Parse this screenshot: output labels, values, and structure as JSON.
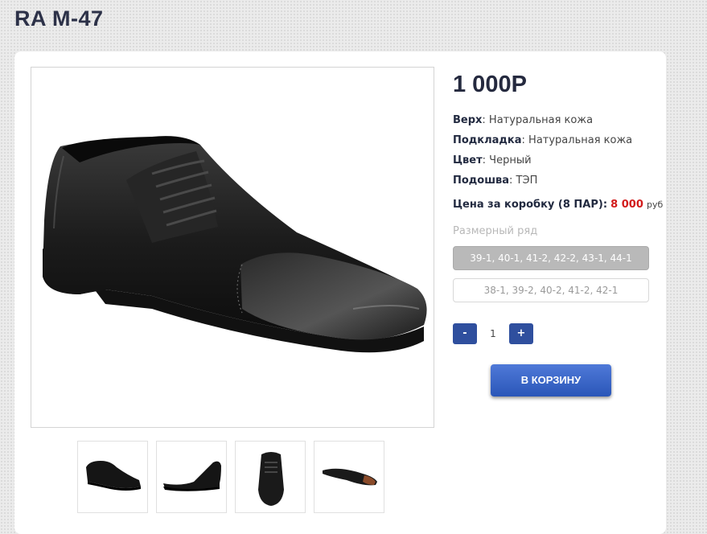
{
  "product": {
    "title": "RA M-47",
    "price": "1 000Р"
  },
  "attributes": [
    {
      "label": "Верх",
      "value": ": Натуральная кожа"
    },
    {
      "label": "Подкладка",
      "value": ": Натуральная кожа"
    },
    {
      "label": "Цвет",
      "value": ": Черный"
    },
    {
      "label": "Подошва",
      "value": ": ТЭП"
    }
  ],
  "box_price": {
    "label": "Цена за коробку (8 ПАР):",
    "value": "8 000",
    "currency": "руб"
  },
  "sizes": {
    "label": "Размерный ряд",
    "options": [
      {
        "text": "39-1, 40-1, 41-2, 42-2, 43-1, 44-1",
        "selected": true
      },
      {
        "text": "38-1, 39-2, 40-2, 41-2, 42-1",
        "selected": false
      }
    ]
  },
  "quantity": {
    "minus": "-",
    "value": "1",
    "plus": "+"
  },
  "cart": {
    "label": "В КОРЗИНУ"
  },
  "colors": {
    "title": "#2c3148",
    "accent_button": "#2f4f9e",
    "price_red": "#d21b1b"
  },
  "icons": [
    "shoe-side-image",
    "shoe-top-image",
    "shoe-sole-image"
  ]
}
